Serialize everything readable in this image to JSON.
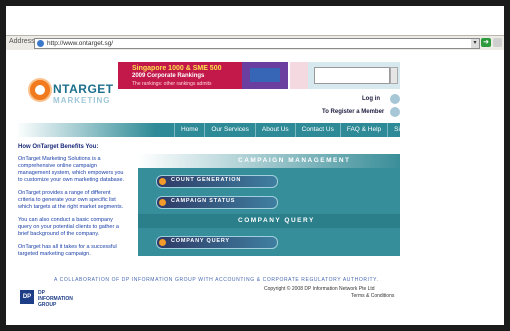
{
  "browser": {
    "address_label": "Address",
    "url": "http://www.ontarget.sg/",
    "go_icon": "green-arrow-go-icon"
  },
  "logo": {
    "brand": "NTARGET",
    "tagline": "MARKETING"
  },
  "banner": {
    "line1": "Singapore 1000 & SME 500",
    "line2": "2009 Corporate Rankings",
    "line3": "The rankings: other rankings admits"
  },
  "account": {
    "login": "Log in",
    "register": "To Register a Member"
  },
  "nav": {
    "items": [
      "Home",
      "Our Services",
      "About Us",
      "Contact Us",
      "FAQ & Help",
      "Site Map"
    ]
  },
  "benefits": {
    "title": "How OnTarget Benefits You:",
    "paragraphs": [
      "OnTarget Marketing Solutions is a comprehensive online campaign management system, which empowers you to customize your own marketing database.",
      "OnTarget provides a range of different criteria to generate your own specific list which targets at the right market segments.",
      "You can also conduct a basic company query on your potential clients to gather a brief background of the company.",
      "OnTarget has all it takes for a successful targeted marketing campaign."
    ]
  },
  "campaign": {
    "title": "CAMPAIGN MANAGEMENT",
    "buttons": [
      "COUNT GENERATION",
      "CAMPAIGN STATUS"
    ]
  },
  "query": {
    "title": "COMPANY QUERY",
    "buttons": [
      "COMPANY QUERY"
    ]
  },
  "footer": {
    "collab": "A COLLABORATION OF DP INFORMATION GROUP WITH ACCOUNTING & CORPORATE REGULATORY AUTHORITY.",
    "dp_logo": "DP",
    "dp_text_1": "DP",
    "dp_text_2": "INFORMATION",
    "dp_text_3": "GROUP",
    "copyright": "Copyright © 2008 DP Information Network Pte Ltd",
    "terms": "Terms & Conditions"
  }
}
